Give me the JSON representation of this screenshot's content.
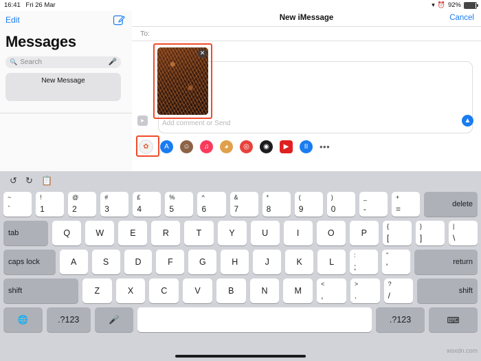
{
  "statusbar": {
    "time": "16:41",
    "date": "Fri 26 Mar",
    "wifi_icon": "wifi-icon",
    "alarm_icon": "alarm-icon",
    "battery_percent": "92%"
  },
  "sidebar": {
    "edit_label": "Edit",
    "compose_icon": "compose-icon",
    "title": "Messages",
    "search": {
      "placeholder": "Search",
      "search_icon": "search-icon",
      "mic_icon": "microphone-icon"
    },
    "conversation": {
      "label": "New Message"
    }
  },
  "compose": {
    "nav_title": "New iMessage",
    "cancel_label": "Cancel",
    "to_label": "To:",
    "attachment": {
      "close_icon": "remove-attachment-icon",
      "description": "pine-needles-photo"
    },
    "comment_placeholder": "Add comment or Send",
    "send_icon": "send-arrow-icon",
    "expand_icon": "expand-app-strip-icon",
    "app_strip": [
      {
        "name": "photos-app",
        "glyph": "✿",
        "color": "#f6f6f6"
      },
      {
        "name": "app-store-app",
        "glyph": "A",
        "color": "#1a7cf0"
      },
      {
        "name": "memoji-app",
        "glyph": "☺",
        "color": "#8d6347"
      },
      {
        "name": "music-app",
        "glyph": "♫",
        "color": "#fa3a5c"
      },
      {
        "name": "animoji-app",
        "glyph": "◕",
        "color": "#e0a14c"
      },
      {
        "name": "images-search-app",
        "glyph": "◎",
        "color": "#e8413c"
      },
      {
        "name": "digital-touch-app",
        "glyph": "◉",
        "color": "#1c1c1e"
      },
      {
        "name": "youtube-app",
        "glyph": "▶",
        "color": "#e02020"
      },
      {
        "name": "apple-pay-app",
        "glyph": "II",
        "color": "#1a7cf0"
      },
      {
        "name": "more-apps",
        "glyph": "•••",
        "color": "transparent"
      }
    ]
  },
  "keyboard": {
    "toolbar": {
      "undo_icon": "undo-icon",
      "redo_icon": "redo-icon",
      "paste_icon": "clipboard-icon"
    },
    "row1": [
      {
        "sup": "~",
        "main": "`"
      },
      {
        "sup": "!",
        "main": "1"
      },
      {
        "sup": "@",
        "main": "2"
      },
      {
        "sup": "#",
        "main": "3"
      },
      {
        "sup": "£",
        "main": "4"
      },
      {
        "sup": "%",
        "main": "5"
      },
      {
        "sup": "^",
        "main": "6"
      },
      {
        "sup": "&",
        "main": "7"
      },
      {
        "sup": "*",
        "main": "8"
      },
      {
        "sup": "(",
        "main": "9"
      },
      {
        "sup": ")",
        "main": "0"
      },
      {
        "sup": "_",
        "main": "-"
      },
      {
        "sup": "+",
        "main": "="
      }
    ],
    "delete_label": "delete",
    "tab_label": "tab",
    "row2": [
      "Q",
      "W",
      "E",
      "R",
      "T",
      "Y",
      "U",
      "I",
      "O",
      "P"
    ],
    "row2_extra": [
      {
        "sup": "{",
        "main": "["
      },
      {
        "sup": "}",
        "main": "]"
      },
      {
        "sup": "|",
        "main": "\\"
      }
    ],
    "caps_label": "caps lock",
    "row3": [
      "A",
      "S",
      "D",
      "F",
      "G",
      "H",
      "J",
      "K",
      "L"
    ],
    "row3_extra": [
      {
        "sup": ":",
        "main": ";"
      },
      {
        "sup": "\"",
        "main": "'"
      }
    ],
    "return_label": "return",
    "shift_left_label": "shift",
    "row4": [
      "Z",
      "X",
      "C",
      "V",
      "B",
      "N",
      "M"
    ],
    "row4_extra": [
      {
        "sup": "<",
        "main": ","
      },
      {
        "sup": ">",
        "main": "."
      },
      {
        "sup": "?",
        "main": "/"
      }
    ],
    "shift_right_label": "shift",
    "globe_icon": "globe-icon",
    "num_left_label": ".?123",
    "dictation_icon": "microphone-icon",
    "space_label": "",
    "num_right_label": ".?123",
    "dismiss_icon": "hide-keyboard-icon"
  },
  "watermark": "wsxdn.com",
  "colors": {
    "accent_blue": "#1a7cf0",
    "highlight_red": "#f04a2a",
    "keyboard_bg": "#d1d3d9",
    "key_white": "#ffffff",
    "key_dark": "#aeb1b8"
  }
}
